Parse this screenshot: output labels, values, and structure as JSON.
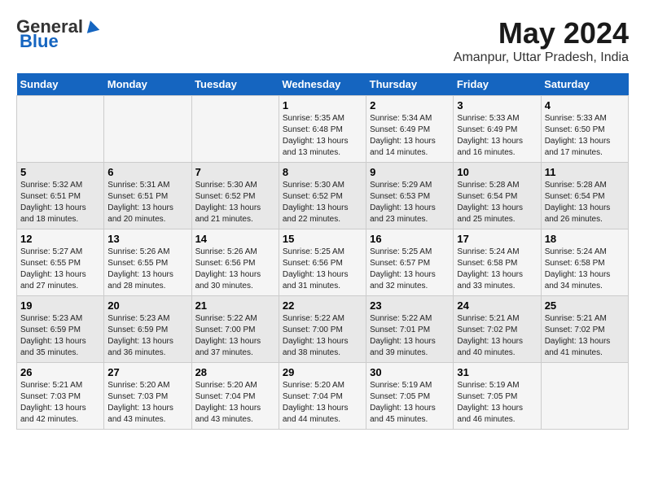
{
  "header": {
    "logo_general": "General",
    "logo_blue": "Blue",
    "title": "May 2024",
    "subtitle": "Amanpur, Uttar Pradesh, India"
  },
  "weekdays": [
    "Sunday",
    "Monday",
    "Tuesday",
    "Wednesday",
    "Thursday",
    "Friday",
    "Saturday"
  ],
  "weeks": [
    [
      {
        "day": "",
        "info": ""
      },
      {
        "day": "",
        "info": ""
      },
      {
        "day": "",
        "info": ""
      },
      {
        "day": "1",
        "info": "Sunrise: 5:35 AM\nSunset: 6:48 PM\nDaylight: 13 hours\nand 13 minutes."
      },
      {
        "day": "2",
        "info": "Sunrise: 5:34 AM\nSunset: 6:49 PM\nDaylight: 13 hours\nand 14 minutes."
      },
      {
        "day": "3",
        "info": "Sunrise: 5:33 AM\nSunset: 6:49 PM\nDaylight: 13 hours\nand 16 minutes."
      },
      {
        "day": "4",
        "info": "Sunrise: 5:33 AM\nSunset: 6:50 PM\nDaylight: 13 hours\nand 17 minutes."
      }
    ],
    [
      {
        "day": "5",
        "info": "Sunrise: 5:32 AM\nSunset: 6:51 PM\nDaylight: 13 hours\nand 18 minutes."
      },
      {
        "day": "6",
        "info": "Sunrise: 5:31 AM\nSunset: 6:51 PM\nDaylight: 13 hours\nand 20 minutes."
      },
      {
        "day": "7",
        "info": "Sunrise: 5:30 AM\nSunset: 6:52 PM\nDaylight: 13 hours\nand 21 minutes."
      },
      {
        "day": "8",
        "info": "Sunrise: 5:30 AM\nSunset: 6:52 PM\nDaylight: 13 hours\nand 22 minutes."
      },
      {
        "day": "9",
        "info": "Sunrise: 5:29 AM\nSunset: 6:53 PM\nDaylight: 13 hours\nand 23 minutes."
      },
      {
        "day": "10",
        "info": "Sunrise: 5:28 AM\nSunset: 6:54 PM\nDaylight: 13 hours\nand 25 minutes."
      },
      {
        "day": "11",
        "info": "Sunrise: 5:28 AM\nSunset: 6:54 PM\nDaylight: 13 hours\nand 26 minutes."
      }
    ],
    [
      {
        "day": "12",
        "info": "Sunrise: 5:27 AM\nSunset: 6:55 PM\nDaylight: 13 hours\nand 27 minutes."
      },
      {
        "day": "13",
        "info": "Sunrise: 5:26 AM\nSunset: 6:55 PM\nDaylight: 13 hours\nand 28 minutes."
      },
      {
        "day": "14",
        "info": "Sunrise: 5:26 AM\nSunset: 6:56 PM\nDaylight: 13 hours\nand 30 minutes."
      },
      {
        "day": "15",
        "info": "Sunrise: 5:25 AM\nSunset: 6:56 PM\nDaylight: 13 hours\nand 31 minutes."
      },
      {
        "day": "16",
        "info": "Sunrise: 5:25 AM\nSunset: 6:57 PM\nDaylight: 13 hours\nand 32 minutes."
      },
      {
        "day": "17",
        "info": "Sunrise: 5:24 AM\nSunset: 6:58 PM\nDaylight: 13 hours\nand 33 minutes."
      },
      {
        "day": "18",
        "info": "Sunrise: 5:24 AM\nSunset: 6:58 PM\nDaylight: 13 hours\nand 34 minutes."
      }
    ],
    [
      {
        "day": "19",
        "info": "Sunrise: 5:23 AM\nSunset: 6:59 PM\nDaylight: 13 hours\nand 35 minutes."
      },
      {
        "day": "20",
        "info": "Sunrise: 5:23 AM\nSunset: 6:59 PM\nDaylight: 13 hours\nand 36 minutes."
      },
      {
        "day": "21",
        "info": "Sunrise: 5:22 AM\nSunset: 7:00 PM\nDaylight: 13 hours\nand 37 minutes."
      },
      {
        "day": "22",
        "info": "Sunrise: 5:22 AM\nSunset: 7:00 PM\nDaylight: 13 hours\nand 38 minutes."
      },
      {
        "day": "23",
        "info": "Sunrise: 5:22 AM\nSunset: 7:01 PM\nDaylight: 13 hours\nand 39 minutes."
      },
      {
        "day": "24",
        "info": "Sunrise: 5:21 AM\nSunset: 7:02 PM\nDaylight: 13 hours\nand 40 minutes."
      },
      {
        "day": "25",
        "info": "Sunrise: 5:21 AM\nSunset: 7:02 PM\nDaylight: 13 hours\nand 41 minutes."
      }
    ],
    [
      {
        "day": "26",
        "info": "Sunrise: 5:21 AM\nSunset: 7:03 PM\nDaylight: 13 hours\nand 42 minutes."
      },
      {
        "day": "27",
        "info": "Sunrise: 5:20 AM\nSunset: 7:03 PM\nDaylight: 13 hours\nand 43 minutes."
      },
      {
        "day": "28",
        "info": "Sunrise: 5:20 AM\nSunset: 7:04 PM\nDaylight: 13 hours\nand 43 minutes."
      },
      {
        "day": "29",
        "info": "Sunrise: 5:20 AM\nSunset: 7:04 PM\nDaylight: 13 hours\nand 44 minutes."
      },
      {
        "day": "30",
        "info": "Sunrise: 5:19 AM\nSunset: 7:05 PM\nDaylight: 13 hours\nand 45 minutes."
      },
      {
        "day": "31",
        "info": "Sunrise: 5:19 AM\nSunset: 7:05 PM\nDaylight: 13 hours\nand 46 minutes."
      },
      {
        "day": "",
        "info": ""
      }
    ]
  ]
}
